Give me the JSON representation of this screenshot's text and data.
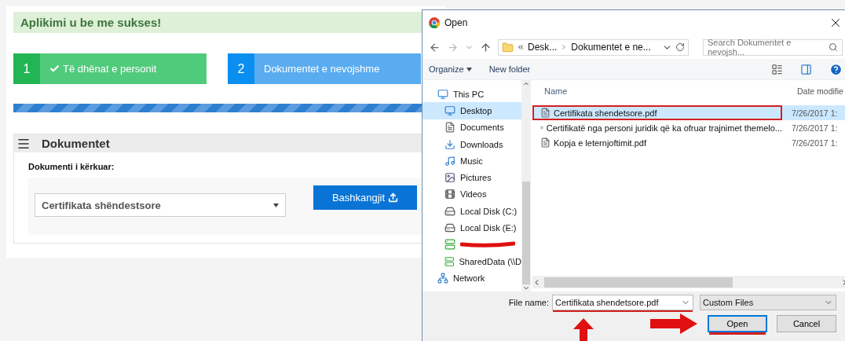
{
  "page": {
    "alert": "Aplikimi u be me sukses!",
    "steps": [
      {
        "number": "1",
        "label": "Të dhënat e personit",
        "done": true
      },
      {
        "number": "2",
        "label": "Dokumentet e nevojshme",
        "done": false
      }
    ],
    "progress": {
      "level": 1
    },
    "panel": {
      "title": "Dokumentet",
      "field_label": "Dokumenti i kërkuar:",
      "select_value": "Certifikata shëndestsore",
      "attach_button": "Bashkangjit"
    }
  },
  "dialog": {
    "title": "Open",
    "breadcrumb": [
      "Desk...",
      "Dokumentet e ne..."
    ],
    "search": {
      "placeholder": "Search Dokumentet e nevojsh..."
    },
    "toolbar": [
      "Organize",
      "New folder"
    ],
    "nav": [
      {
        "label": "This PC",
        "kind": "pc",
        "selected": false,
        "children": [
          {
            "label": "Desktop",
            "kind": "desktop",
            "selected": true
          },
          {
            "label": "Documents",
            "kind": "documents",
            "selected": false
          },
          {
            "label": "Downloads",
            "kind": "downloads",
            "selected": false
          },
          {
            "label": "Music",
            "kind": "music",
            "selected": false
          },
          {
            "label": "Pictures",
            "kind": "pictures",
            "selected": false
          },
          {
            "label": "Videos",
            "kind": "videos",
            "selected": false
          },
          {
            "label": "Local Disk (C:)",
            "kind": "disk",
            "selected": false
          },
          {
            "label": "Local Disk (E:)",
            "kind": "disk",
            "selected": false
          },
          {
            "kind": "netdrive",
            "redacted": true,
            "selected": false
          },
          {
            "label": "SharedData (\\\\D",
            "kind": "netdrive",
            "selected": false
          }
        ]
      },
      {
        "label": "Network",
        "kind": "network",
        "selected": false
      }
    ],
    "columns": [
      "Name",
      "Date modifie"
    ],
    "files": [
      {
        "name": "Certifikata shendetsore.pdf",
        "date": "7/26/2017 1:",
        "selected": true,
        "highlighted": true
      },
      {
        "name": "Certifikatë nga personi juridik që ka ofruar trajnimet themelo...",
        "date": "7/26/2017 1:",
        "selected": false,
        "highlighted": false
      },
      {
        "name": "Kopja e leternjoftimit.pdf",
        "date": "7/26/2017 1:",
        "selected": false,
        "highlighted": false
      }
    ],
    "file_name_label": "File name:",
    "file_name": {
      "value": "Certifikata shendetsore.pdf",
      "underlined": true
    },
    "filter": "Custom Files",
    "buttons": [
      {
        "label": "Open",
        "default": true,
        "underlined": true
      },
      {
        "label": "Cancel",
        "default": false,
        "underlined": false
      }
    ],
    "annotations": [
      {
        "kind": "up-arrow"
      },
      {
        "kind": "right-arrow"
      }
    ]
  }
}
